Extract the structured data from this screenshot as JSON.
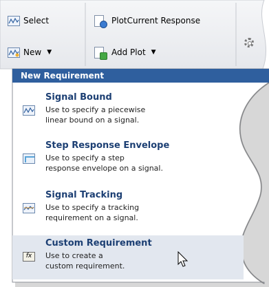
{
  "toolbar": {
    "select_label": "Select",
    "plot_current_label": "PlotCurrent Response",
    "new_label": "New",
    "add_plot_label": "Add Plot"
  },
  "menu": {
    "header": "New Requirement",
    "items": [
      {
        "title": "Signal Bound",
        "description": "Use to specify a piecewise\nlinear bound on a signal.",
        "icon": "signal-bound-icon"
      },
      {
        "title": "Step Response Envelope",
        "description": "Use to specify a step\nresponse envelope on a signal.",
        "icon": "step-response-icon"
      },
      {
        "title": "Signal Tracking",
        "description": "Use to specify a tracking\nrequirement on a signal.",
        "icon": "signal-tracking-icon"
      },
      {
        "title": "Custom Requirement",
        "description": "Use to create a\ncustom requirement.",
        "icon": "custom-requirement-icon"
      }
    ]
  },
  "colors": {
    "menu_header_bg": "#2f5f9e",
    "menu_title": "#1c3f73",
    "hover_bg": "#e2e7ef",
    "toolbar_bg": "#edeef0"
  }
}
